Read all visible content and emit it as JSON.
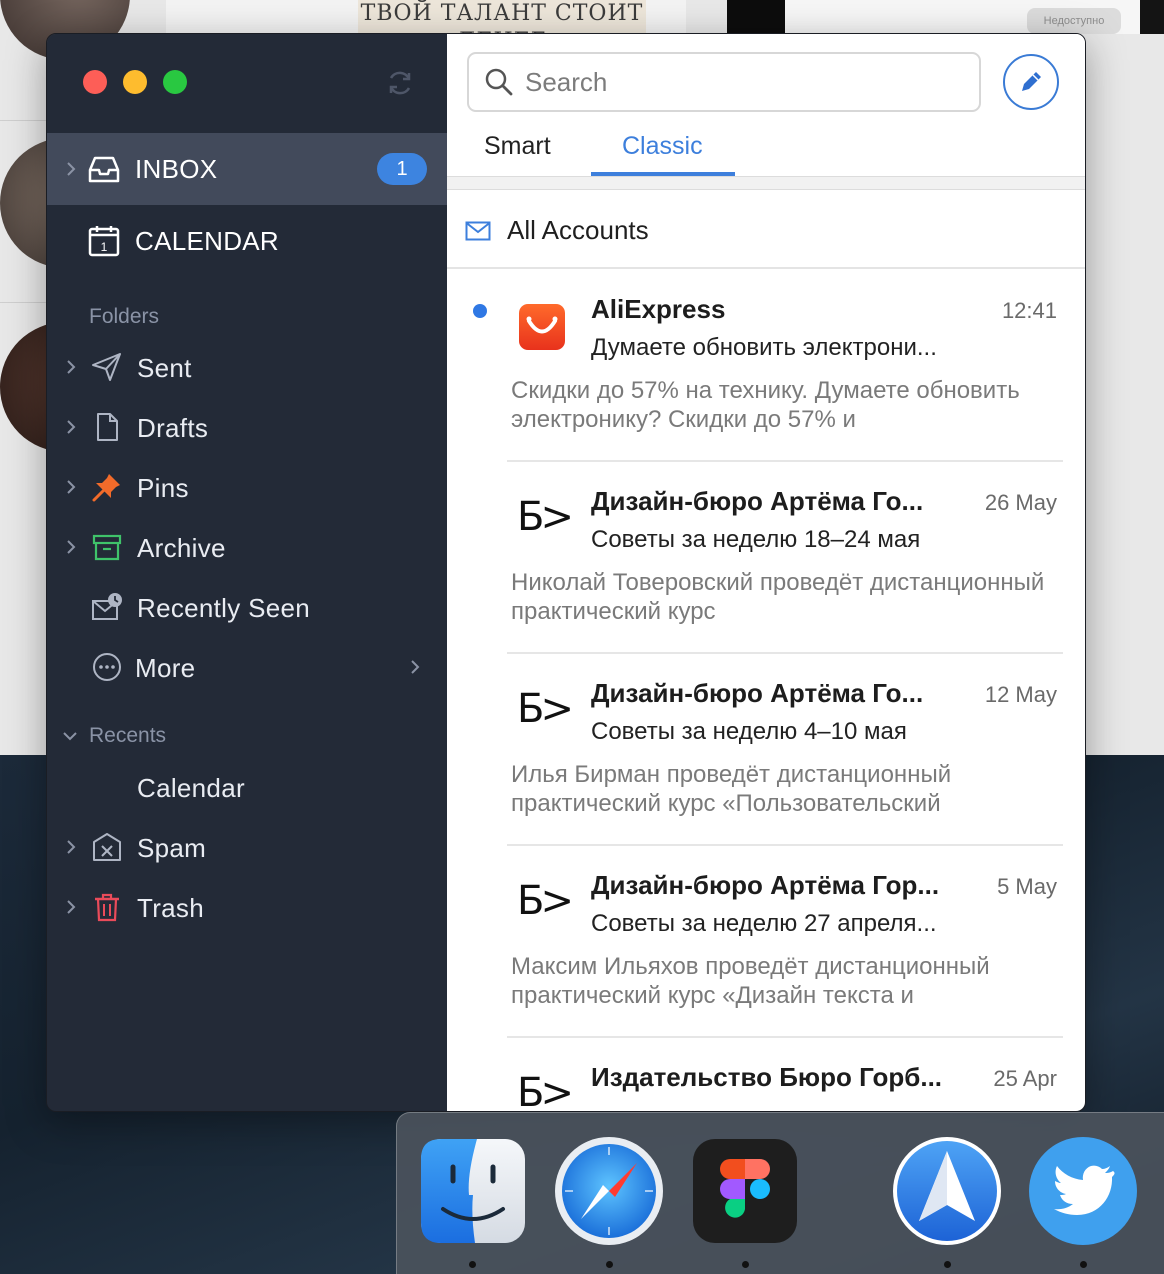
{
  "background": {
    "banner_text": "ТВОЙ ТАЛАНТ СТОИТ ДЕНЕГ",
    "pill_text": "Недоступно"
  },
  "sidebar": {
    "primary": [
      {
        "label": "INBOX",
        "badge": "1",
        "icon": "inbox-icon",
        "active": true
      },
      {
        "label": "CALENDAR",
        "icon": "calendar-icon",
        "calendar_day": "1",
        "active": false
      }
    ],
    "folders_title": "Folders",
    "folders": [
      {
        "label": "Sent",
        "icon": "send-icon"
      },
      {
        "label": "Drafts",
        "icon": "document-icon"
      },
      {
        "label": "Pins",
        "icon": "pin-icon"
      },
      {
        "label": "Archive",
        "icon": "archive-icon"
      },
      {
        "label": "Recently Seen",
        "icon": "recently-seen-icon"
      },
      {
        "label": "More",
        "icon": "more-icon"
      }
    ],
    "recents_title": "Recents",
    "recents": [
      {
        "label": "Calendar"
      }
    ],
    "bottom_folders": [
      {
        "label": "Spam",
        "icon": "spam-icon"
      },
      {
        "label": "Trash",
        "icon": "trash-icon"
      }
    ]
  },
  "list": {
    "search_placeholder": "Search",
    "tabs": [
      {
        "label": "Smart"
      },
      {
        "label": "Classic"
      }
    ],
    "accounts_label": "All Accounts",
    "messages": [
      {
        "sender": "AliExpress",
        "time": "12:41",
        "subject": "Думаете обновить электрони...",
        "preview": "Скидки до 57% на технику. Думаете обновить электронику? Скидки до 57% и",
        "unread": true,
        "icon": "aliexpress-icon"
      },
      {
        "sender": "Дизайн-бюро Артёма Го...",
        "time": "26 May",
        "subject": "Советы за неделю 18–24 мая",
        "preview": "Николай Товеровский проведёт дистанционный практический курс",
        "unread": false,
        "icon": "bureau-logo-icon",
        "logo_text": "Б>"
      },
      {
        "sender": "Дизайн-бюро Артёма Го...",
        "time": "12 May",
        "subject": "Советы за неделю 4–10 мая",
        "preview": "Илья Бирман проведёт дистанционный практический курс «Пользовательский",
        "unread": false,
        "icon": "bureau-logo-icon",
        "logo_text": "Б>"
      },
      {
        "sender": "Дизайн-бюро Артёма Гор...",
        "time": "5 May",
        "subject": "Советы за неделю 27 апреля...",
        "preview": "Максим Ильяхов проведёт дистанционный практический курс «Дизайн текста и",
        "unread": false,
        "icon": "bureau-logo-icon",
        "logo_text": "Б>"
      },
      {
        "sender": "Издательство Бюро Горб...",
        "time": "25 Apr",
        "subject": "",
        "preview": "",
        "unread": false,
        "icon": "bureau-logo-icon",
        "logo_text": "Б>"
      }
    ]
  },
  "dock": {
    "apps": [
      {
        "name": "Finder",
        "icon": "finder-icon"
      },
      {
        "name": "Safari",
        "icon": "safari-icon"
      },
      {
        "name": "Figma",
        "icon": "figma-icon"
      },
      {
        "name": "Spark",
        "icon": "spark-icon"
      },
      {
        "name": "Twitter",
        "icon": "twitter-icon"
      }
    ]
  },
  "colors": {
    "sidebar_bg": "#232a37",
    "sidebar_active": "#424a5b",
    "accent": "#3d7fdc",
    "badge": "#3d84e0",
    "unread_dot": "#2f78e4"
  }
}
